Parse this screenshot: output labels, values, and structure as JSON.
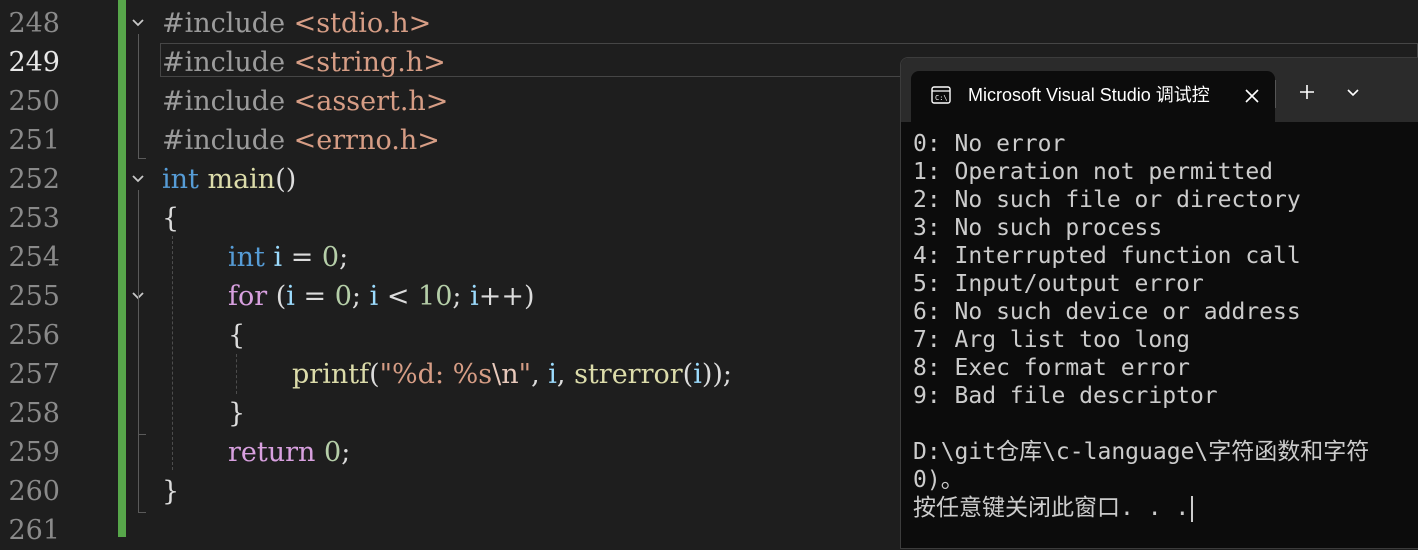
{
  "editor": {
    "line_numbers": [
      "248",
      "249",
      "250",
      "251",
      "252",
      "253",
      "254",
      "255",
      "256",
      "257",
      "258",
      "259",
      "260",
      "261"
    ],
    "current_line": "249",
    "code": {
      "l248": {
        "directive": "#include",
        "header": "<stdio.h>"
      },
      "l249": {
        "directive": "#include",
        "header": "<string.h>"
      },
      "l250": {
        "directive": "#include",
        "header": "<assert.h>"
      },
      "l251": {
        "directive": "#include",
        "header": "<errno.h>"
      },
      "l252": {
        "type": "int",
        "name": "main",
        "parens": "()"
      },
      "l253": {
        "brace": "{"
      },
      "l254": {
        "type": "int",
        "var": "i",
        "eq": " = ",
        "num": "0",
        "semi": ";"
      },
      "l255": {
        "kw": "for",
        "open": " (",
        "var1": "i",
        "eq": " = ",
        "num1": "0",
        "semi1": "; ",
        "var2": "i",
        "lt": " < ",
        "num2": "10",
        "semi2": "; ",
        "var3": "i",
        "inc": "++)"
      },
      "l256": {
        "brace": "{"
      },
      "l257": {
        "fn": "printf",
        "open": "(",
        "str1": "\"%d: %s",
        "esc": "\\n",
        "str2": "\"",
        "comma1": ", ",
        "var": "i",
        "comma2": ", ",
        "fn2": "strerror",
        "open2": "(",
        "var2": "i",
        "close": "));"
      },
      "l258": {
        "brace": "}"
      },
      "l259": {
        "kw": "return",
        "num": "0",
        "semi": ";"
      },
      "l260": {
        "brace": "}"
      }
    },
    "colors": {
      "change_bar": "#57a64a",
      "keyword": "#569cd6",
      "control": "#d8a0df",
      "function": "#dcdcaa",
      "variable": "#9cdcfe",
      "number": "#b5cea8",
      "string": "#d69d85"
    }
  },
  "console": {
    "tab_title": "Microsoft Visual Studio 调试控",
    "tab_icon": "terminal-icon",
    "close_icon": "close-icon",
    "new_tab_icon": "plus-icon",
    "dropdown_icon": "chevron-down-icon",
    "output_lines": [
      "0: No error",
      "1: Operation not permitted",
      "2: No such file or directory",
      "3: No such process",
      "4: Interrupted function call",
      "5: Input/output error",
      "6: No such device or address",
      "7: Arg list too long",
      "8: Exec format error",
      "9: Bad file descriptor",
      "",
      "D:\\git仓库\\c-language\\字符函数和字符",
      "0)。",
      "按任意键关闭此窗口. . ."
    ]
  }
}
